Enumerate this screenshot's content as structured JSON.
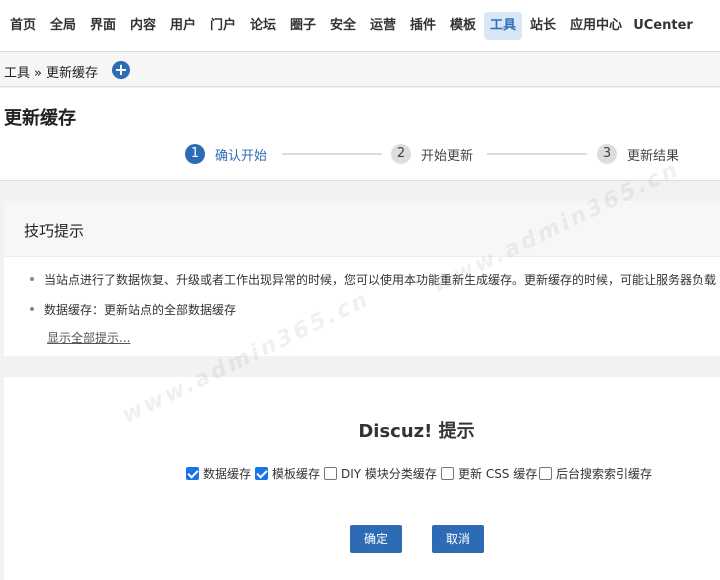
{
  "nav": {
    "items": [
      {
        "label": "首页",
        "active": false
      },
      {
        "label": "全局",
        "active": false
      },
      {
        "label": "界面",
        "active": false
      },
      {
        "label": "内容",
        "active": false
      },
      {
        "label": "用户",
        "active": false
      },
      {
        "label": "门户",
        "active": false
      },
      {
        "label": "论坛",
        "active": false
      },
      {
        "label": "圈子",
        "active": false
      },
      {
        "label": "安全",
        "active": false
      },
      {
        "label": "运营",
        "active": false
      },
      {
        "label": "插件",
        "active": false
      },
      {
        "label": "模板",
        "active": false
      },
      {
        "label": "工具",
        "active": true
      },
      {
        "label": "站长",
        "active": false
      },
      {
        "label": "应用中心",
        "active": false
      },
      {
        "label": "UCenter",
        "active": false
      }
    ]
  },
  "breadcrumb": {
    "section": "工具",
    "separator": "»",
    "page": "更新缓存",
    "add_icon": "plus-circle-icon"
  },
  "page_title": "更新缓存",
  "steps": [
    {
      "num": "1",
      "label": "确认开始",
      "active": true
    },
    {
      "num": "2",
      "label": "开始更新",
      "active": false
    },
    {
      "num": "3",
      "label": "更新结果",
      "active": false
    }
  ],
  "tips": {
    "title": "技巧提示",
    "items": [
      "当站点进行了数据恢复、升级或者工作出现异常的时候，您可以使用本功能重新生成缓存。更新缓存的时候，可能让服务器负载",
      "数据缓存：更新站点的全部数据缓存"
    ],
    "show_all": "显示全部提示..."
  },
  "dialog": {
    "title": "Discuz! 提示",
    "options": [
      {
        "label": "数据缓存",
        "checked": true
      },
      {
        "label": "模板缓存",
        "checked": true
      },
      {
        "label": "DIY 模块分类缓存",
        "checked": false
      },
      {
        "label": "更新 CSS 缓存",
        "checked": false
      },
      {
        "label": "后台搜索索引缓存",
        "checked": false
      }
    ],
    "confirm": "确定",
    "cancel": "取消"
  },
  "watermark": "www.admin365.cn",
  "colors": {
    "accent": "#2d6cb5",
    "active_tab_bg": "#d8e6f6",
    "checkbox": "#1a73e8"
  }
}
